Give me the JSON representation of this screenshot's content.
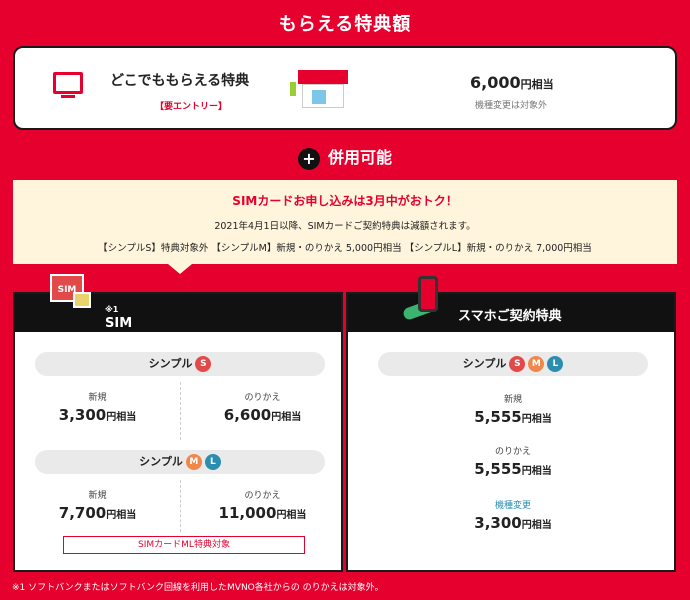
{
  "page": {
    "title": "もらえる特典額",
    "combinable": "併用可能",
    "footnote": "※1 ソフトバンクまたはソフトバンク回線を利用したMVNO各社からの のりかえは対象外。"
  },
  "top": {
    "headline": "どこでももらえる特典",
    "entry": "【要エントリー】",
    "amount_value": "6,000",
    "amount_unit": "円相当",
    "note": "機種変更は対象外"
  },
  "notice": {
    "headline": "SIMカードお申し込みは3月中がおトク！",
    "line2": "2021年4月1日以降、SIMカードご契約特典は減額されます。",
    "line3": "【シンプルS】特典対象外 【シンプルM】新規・のりかえ 5,000円相当 【シンプルL】新規・のりかえ 7,000円相当"
  },
  "left": {
    "header": "SIMカードご契約特典",
    "header_sup": "※1",
    "sim_label": "SIM",
    "plan1": "シンプル",
    "badge_s": "S",
    "plan2": "シンプル",
    "badge_m": "M",
    "badge_l": "L",
    "p1_new_label": "新規",
    "p1_new_value": "3,300",
    "p1_switch_label": "のりかえ",
    "p1_switch_value": "6,600",
    "p2_new_label": "新規",
    "p2_new_value": "7,700",
    "p2_switch_label": "のりかえ",
    "p2_switch_value": "11,000",
    "unit": "円相当",
    "ml_note": "SIMカードML特典対象"
  },
  "right": {
    "header": "スマホご契約特典",
    "plan": "シンプル",
    "badge_s": "S",
    "badge_m": "M",
    "badge_l": "L",
    "new_label": "新規",
    "new_value": "5,555",
    "switch_label": "のりかえ",
    "switch_value": "5,555",
    "device_label": "機種変更",
    "device_value": "3,300",
    "unit": "円相当"
  },
  "colors": {
    "brand_red": "#e6002d",
    "notice_bg": "#fff4dc",
    "badge_s": "#e24a4a",
    "badge_m": "#f0874b",
    "badge_l": "#2b8eb0"
  }
}
